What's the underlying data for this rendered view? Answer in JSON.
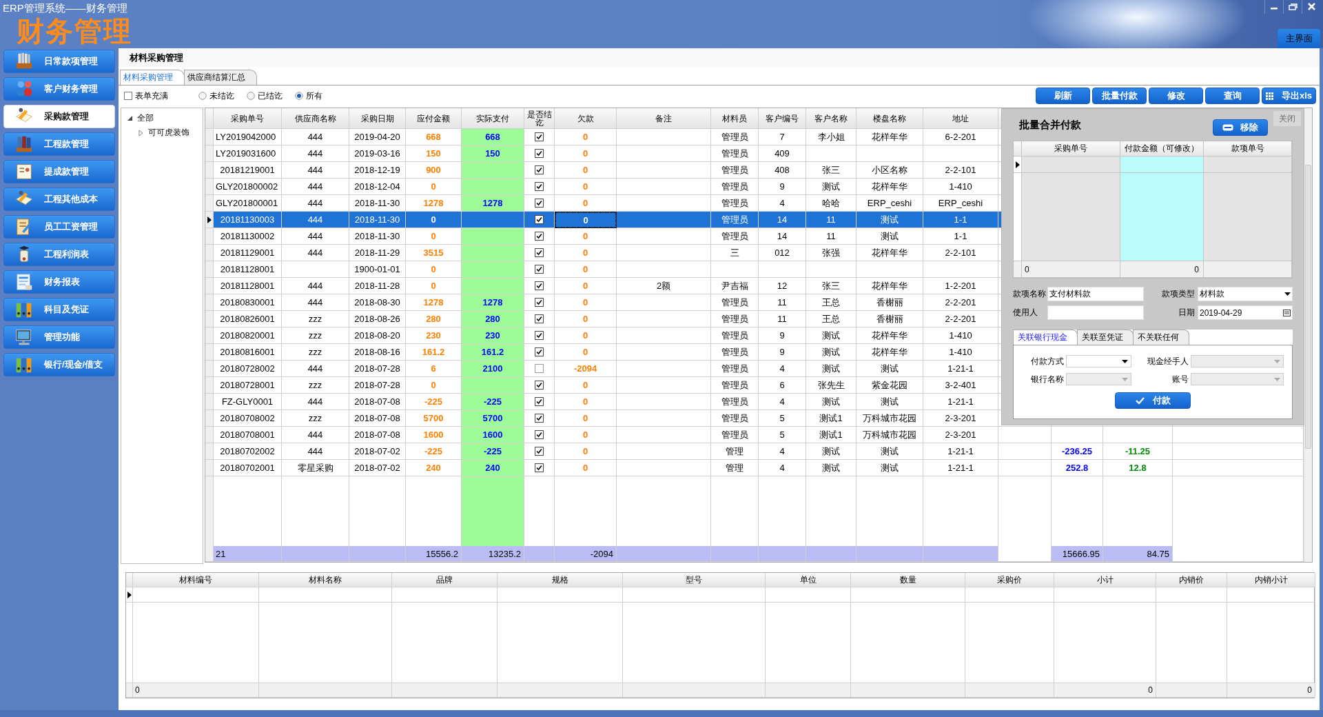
{
  "window": {
    "title": "ERP管理系统——财务管理",
    "logo_text": "财务管理",
    "home_tab": "主界面"
  },
  "sidebar": {
    "items": [
      {
        "label": "日常款项管理",
        "selected": false
      },
      {
        "label": "客户财务管理",
        "selected": false
      },
      {
        "label": "采购款管理",
        "selected": true
      },
      {
        "label": "工程款管理",
        "selected": false
      },
      {
        "label": "提成款管理",
        "selected": false
      },
      {
        "label": "工程其他成本",
        "selected": false
      },
      {
        "label": "员工工资管理",
        "selected": false
      },
      {
        "label": "工程利润表",
        "selected": false
      },
      {
        "label": "财务报表",
        "selected": false
      },
      {
        "label": "科目及凭证",
        "selected": false
      },
      {
        "label": "管理功能",
        "selected": false
      },
      {
        "label": "银行/现金/借支",
        "selected": false
      }
    ]
  },
  "page": {
    "title": "材料采购管理"
  },
  "tabs": [
    {
      "label": "材料采购管理",
      "selected": true
    },
    {
      "label": "供应商结算汇总",
      "selected": false
    }
  ],
  "filters": {
    "fill_form": {
      "label": "表单充满",
      "checked": false
    },
    "status_options": [
      {
        "label": "未结讫",
        "selected": false
      },
      {
        "label": "已结讫",
        "selected": false
      },
      {
        "label": "所有",
        "selected": true
      }
    ]
  },
  "toolbar": {
    "buttons": [
      {
        "label": "刷新",
        "kind": "plain"
      },
      {
        "label": "批量付款",
        "kind": "plain"
      },
      {
        "label": "修改",
        "kind": "plain"
      },
      {
        "label": "查询",
        "kind": "plain"
      },
      {
        "label": "导出xls",
        "kind": "export"
      }
    ]
  },
  "tree": [
    {
      "label": "全部",
      "expanded": true,
      "children": [
        {
          "label": "可可虎装饰",
          "expanded": false
        }
      ]
    }
  ],
  "purchase_table": {
    "columns": [
      {
        "label": "采购单号",
        "kind": "text"
      },
      {
        "label": "供应商名称",
        "kind": "text"
      },
      {
        "label": "采购日期",
        "kind": "text"
      },
      {
        "label": "应付金额",
        "kind": "orange_amount"
      },
      {
        "label": "实际支付",
        "kind": "paid_amount"
      },
      {
        "label": "是否结讫",
        "kind": "check"
      },
      {
        "label": "欠款",
        "kind": "orange_amount"
      },
      {
        "label": "备注",
        "kind": "text"
      },
      {
        "label": "材料员",
        "kind": "text"
      },
      {
        "label": "客户编号",
        "kind": "text"
      },
      {
        "label": "客户名称",
        "kind": "text"
      },
      {
        "label": "楼盘名称",
        "kind": "text"
      },
      {
        "label": "地址",
        "kind": "text"
      },
      {
        "kind": "blue_amount"
      },
      {
        "kind": "green_amount"
      }
    ],
    "rows": [
      {
        "order_no": "LY2019042000",
        "supplier": "444",
        "date": "2019-04-20",
        "payable": "668",
        "paid": "668",
        "settled": true,
        "debt": "0",
        "clerk": "管理员",
        "customer_no": "7",
        "customer_name": "李小姐",
        "estate": "花样年华",
        "address": "6-2-201",
        "selected": false
      },
      {
        "order_no": "LY2019031600",
        "supplier": "444",
        "date": "2019-03-16",
        "payable": "150",
        "paid": "150",
        "settled": true,
        "debt": "0",
        "clerk": "管理员",
        "customer_no": "409",
        "selected": false
      },
      {
        "order_no": "20181219001",
        "supplier": "444",
        "date": "2018-12-19",
        "payable": "900",
        "settled": true,
        "debt": "0",
        "clerk": "管理员",
        "customer_no": "408",
        "customer_name": "张三",
        "estate": "小区名称",
        "address": "2-2-101",
        "selected": false
      },
      {
        "order_no": "GLY201800002",
        "supplier": "444",
        "date": "2018-12-04",
        "payable": "0",
        "settled": true,
        "debt": "0",
        "clerk": "管理员",
        "customer_no": "9",
        "customer_name": "测试",
        "estate": "花样年华",
        "address": "1-410",
        "selected": false
      },
      {
        "order_no": "GLY201800001",
        "supplier": "444",
        "date": "2018-11-30",
        "payable": "1278",
        "paid": "1278",
        "settled": true,
        "debt": "0",
        "clerk": "管理员",
        "customer_no": "4",
        "customer_name": "哈哈",
        "estate": "ERP_ceshi",
        "address": "ERP_ceshi",
        "selected": false
      },
      {
        "order_no": "20181130003",
        "supplier": "444",
        "date": "2018-11-30",
        "payable": "0",
        "settled": true,
        "debt": "0",
        "clerk": "管理员",
        "customer_no": "14",
        "customer_name": "11",
        "estate": "测试",
        "address": "1-1",
        "selected": true
      },
      {
        "order_no": "20181130002",
        "supplier": "444",
        "date": "2018-11-30",
        "payable": "0",
        "settled": true,
        "debt": "0",
        "clerk": "管理员",
        "customer_no": "14",
        "customer_name": "11",
        "estate": "测试",
        "address": "1-1",
        "selected": false
      },
      {
        "order_no": "20181129001",
        "supplier": "444",
        "date": "2018-11-29",
        "payable": "3515",
        "settled": true,
        "debt": "0",
        "clerk": "三",
        "customer_no": "012",
        "customer_name": "张强",
        "estate": "花样年华",
        "address": "2-2-101",
        "selected": false
      },
      {
        "order_no": "20181128001",
        "date": "1900-01-01",
        "payable": "0",
        "settled": true,
        "debt": "0",
        "selected": false
      },
      {
        "order_no": "20181128001",
        "supplier": "444",
        "date": "2018-11-28",
        "payable": "0",
        "settled": true,
        "debt": "0",
        "remark": "2额",
        "clerk": "尹吉福",
        "customer_no": "12",
        "customer_name": "张三",
        "estate": "花样年华",
        "address": "1-2-201",
        "selected": false
      },
      {
        "order_no": "20180830001",
        "supplier": "444",
        "date": "2018-08-30",
        "payable": "1278",
        "paid": "1278",
        "settled": true,
        "debt": "0",
        "clerk": "管理员",
        "customer_no": "11",
        "customer_name": "王总",
        "estate": "香榭丽",
        "address": "2-2-201",
        "selected": false
      },
      {
        "order_no": "20180826001",
        "supplier": "zzz",
        "date": "2018-08-26",
        "payable": "280",
        "paid": "280",
        "settled": true,
        "debt": "0",
        "clerk": "管理员",
        "customer_no": "11",
        "customer_name": "王总",
        "estate": "香榭丽",
        "address": "2-2-201",
        "selected": false
      },
      {
        "order_no": "20180820001",
        "supplier": "zzz",
        "date": "2018-08-20",
        "payable": "230",
        "paid": "230",
        "settled": true,
        "debt": "0",
        "clerk": "管理员",
        "customer_no": "9",
        "customer_name": "测试",
        "estate": "花样年华",
        "address": "1-410",
        "selected": false
      },
      {
        "order_no": "20180816001",
        "supplier": "zzz",
        "date": "2018-08-16",
        "payable": "161.2",
        "paid": "161.2",
        "settled": true,
        "debt": "0",
        "clerk": "管理员",
        "customer_no": "9",
        "customer_name": "测试",
        "estate": "花样年华",
        "address": "1-410",
        "selected": false
      },
      {
        "order_no": "20180728002",
        "supplier": "444",
        "date": "2018-07-28",
        "payable": "6",
        "paid": "2100",
        "settled": false,
        "debt": "-2094",
        "clerk": "管理员",
        "customer_no": "4",
        "customer_name": "测试",
        "estate": "测试",
        "address": "1-21-1",
        "selected": false
      },
      {
        "order_no": "20180728001",
        "supplier": "zzz",
        "date": "2018-07-28",
        "payable": "0",
        "settled": true,
        "debt": "0",
        "clerk": "管理员",
        "customer_no": "6",
        "customer_name": "张先生",
        "estate": "紫金花园",
        "address": "3-2-401",
        "selected": false
      },
      {
        "order_no": "FZ-GLY0001",
        "supplier": "444",
        "date": "2018-07-08",
        "payable": "-225",
        "paid": "-225",
        "settled": true,
        "debt": "0",
        "clerk": "管理员",
        "customer_no": "4",
        "customer_name": "测试",
        "estate": "测试",
        "address": "1-21-1",
        "selected": false
      },
      {
        "order_no": "20180708002",
        "supplier": "zzz",
        "date": "2018-07-08",
        "payable": "5700",
        "paid": "5700",
        "settled": true,
        "debt": "0",
        "clerk": "管理员",
        "customer_no": "5",
        "customer_name": "测试1",
        "estate": "万科城市花园",
        "address": "2-3-201",
        "selected": false
      },
      {
        "order_no": "20180708001",
        "supplier": "444",
        "date": "2018-07-08",
        "payable": "1600",
        "paid": "1600",
        "settled": true,
        "debt": "0",
        "clerk": "管理员",
        "customer_no": "5",
        "customer_name": "测试1",
        "estate": "万科城市花园",
        "address": "2-3-201",
        "selected": false
      },
      {
        "order_no": "20180702002",
        "supplier": "444",
        "date": "2018-07-02",
        "payable": "-225",
        "paid": "-225",
        "settled": true,
        "debt": "0",
        "clerk": "管理",
        "customer_no": "4",
        "customer_name": "测试",
        "estate": "测试",
        "address": "1-21-1",
        "column_15": "-236.25",
        "column_16": "-11.25",
        "selected": false
      },
      {
        "order_no": "20180702001",
        "supplier": "零星采购",
        "date": "2018-07-02",
        "payable": "240",
        "paid": "240",
        "settled": true,
        "debt": "0",
        "clerk": "管理",
        "customer_no": "4",
        "customer_name": "测试",
        "estate": "测试",
        "address": "1-21-1",
        "column_15": "252.8",
        "column_16": "12.8",
        "selected": false
      }
    ],
    "totals": {
      "count": "21",
      "payable": "15556.2",
      "paid": "13235.2",
      "debt": "-2094",
      "column_15": "15666.95",
      "column_16": "84.75"
    }
  },
  "batch_payment": {
    "title": "批量合并付款",
    "remove_button": "移除",
    "close_button": "关闭",
    "columns": [
      "采购单号",
      "付款金额（可修改）",
      "款项单号"
    ],
    "totals": {
      "count": "0",
      "amount": "0"
    },
    "fields": [
      {
        "label": "款项名称",
        "value": "支付材料款",
        "kind": "text"
      },
      {
        "label": "款项类型",
        "value": "材料款",
        "kind": "dropdown"
      },
      {
        "label": "使用人",
        "kind": "text"
      },
      {
        "label": "日期",
        "value": "2019-04-29",
        "kind": "date"
      }
    ],
    "tabs": [
      {
        "label": "关联银行现金",
        "selected": true
      },
      {
        "label": "关联至凭证",
        "selected": false
      },
      {
        "label": "不关联任何",
        "selected": false
      }
    ],
    "tab_fields": [
      {
        "label": "付款方式",
        "disabled": false
      },
      {
        "label": "现金经手人",
        "disabled": true
      },
      {
        "label": "银行名称",
        "disabled": true
      },
      {
        "label": "账号",
        "disabled": true
      }
    ],
    "pay_button": "付款"
  },
  "detail_table": {
    "columns": [
      "材料编号",
      "材料名称",
      "品牌",
      "规格",
      "型号",
      "单位",
      "数量",
      "采购价",
      "小计",
      "内销价",
      "内销小计"
    ],
    "totals": {
      "count": "0",
      "subtotal": "0",
      "domestic_subtotal": "0"
    }
  }
}
